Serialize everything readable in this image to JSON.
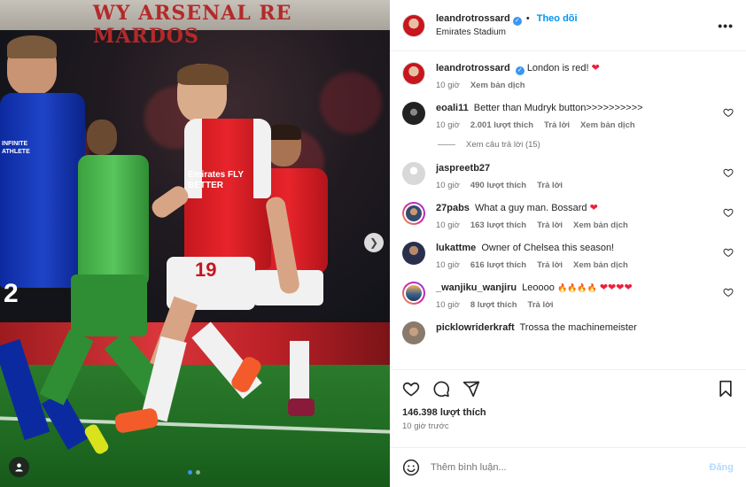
{
  "photo": {
    "banner_text": "WY ARSENAL RE MARDOS",
    "jersey_number": "19",
    "opponent_number": "2",
    "sponsor_text": "Emirates FLY BETTER",
    "opponent_sponsor": "INFINITE ATHLETE",
    "carousel_dots": 2,
    "active_dot": 0
  },
  "post": {
    "author": "leandrotrossard",
    "follow_label": "Theo dõi",
    "location": "Emirates Stadium",
    "more_label": "•••"
  },
  "caption": {
    "user": "leandrotrossard",
    "text": "London is red!",
    "time": "10 giờ",
    "translate": "Xem bản dịch"
  },
  "comments": [
    {
      "user": "eoali11",
      "text": "Better than Mudryk button>>>>>>>>>>",
      "time": "10 giờ",
      "likes": "2.001 lượt thích",
      "reply": "Trả lời",
      "translate": "Xem bản dịch",
      "view_replies": "Xem câu trả lời (15)"
    },
    {
      "user": "jaspreetb27",
      "text": "",
      "time": "10 giờ",
      "likes": "490 lượt thích",
      "reply": "Trả lời"
    },
    {
      "user": "27pabs",
      "text": "What a guy man. Bossard",
      "time": "10 giờ",
      "likes": "163 lượt thích",
      "reply": "Trả lời",
      "translate": "Xem bản dịch"
    },
    {
      "user": "lukattme",
      "text": "Owner of Chelsea this season!",
      "time": "10 giờ",
      "likes": "616 lượt thích",
      "reply": "Trả lời",
      "translate": "Xem bản dịch"
    },
    {
      "user": "_wanjiku_wanjiru",
      "text": "Leoooo",
      "time": "10 giờ",
      "likes": "8 lượt thích",
      "reply": "Trả lời"
    },
    {
      "user": "picklowriderkraft",
      "text": "Trossa the machinemeister"
    }
  ],
  "footer": {
    "likes": "146.398 lượt thích",
    "posted": "10 giờ trước",
    "comment_placeholder": "Thêm bình luận...",
    "post_label": "Đăng"
  },
  "icons": {
    "heart": "heart-icon",
    "comment": "comment-icon",
    "share": "share-icon",
    "save": "bookmark-icon",
    "emoji": "emoji-icon"
  },
  "colors": {
    "link_blue": "#0095f6",
    "verified_blue": "#3897f0",
    "heart_red": "#ed1f3a",
    "muted": "#737373"
  }
}
